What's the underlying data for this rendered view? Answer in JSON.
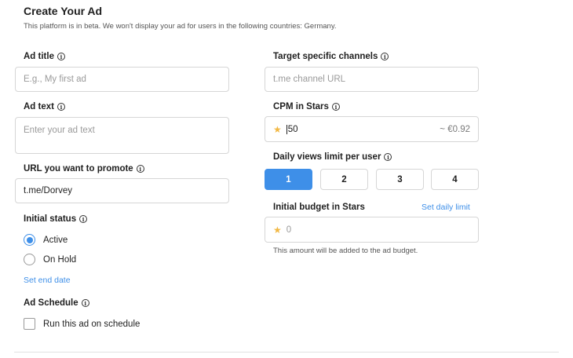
{
  "header": {
    "title": "Create Your Ad",
    "subtitle": "This platform is in beta. We won't display your ad for users in the following countries: Germany."
  },
  "info_icon": "i",
  "ad_title": {
    "label": "Ad title",
    "placeholder": "E.g., My first ad"
  },
  "ad_text": {
    "label": "Ad text",
    "placeholder": "Enter your ad text"
  },
  "url": {
    "label": "URL you want to promote",
    "value": "t.me/Dorvey"
  },
  "initial_status": {
    "label": "Initial status",
    "options": [
      {
        "label": "Active",
        "selected": true
      },
      {
        "label": "On Hold",
        "selected": false
      }
    ],
    "set_end_date": "Set end date"
  },
  "ad_schedule": {
    "label": "Ad Schedule",
    "checkbox_label": "Run this ad on schedule",
    "checked": false
  },
  "target_channels": {
    "label": "Target specific channels",
    "placeholder": "t.me channel URL"
  },
  "cpm": {
    "label": "CPM in Stars",
    "value": "50",
    "fiat": "~ €0.92",
    "icon": "star-icon"
  },
  "daily_views": {
    "label": "Daily views limit per user",
    "options": [
      "1",
      "2",
      "3",
      "4"
    ],
    "selected": "1"
  },
  "budget": {
    "label": "Initial budget in Stars",
    "set_daily_limit": "Set daily limit",
    "placeholder": "0",
    "note": "This amount will be added to the ad budget.",
    "icon": "star-icon"
  },
  "colors": {
    "accent": "#3e8fe8",
    "star": "#f2b844",
    "border": "#d6d6d6"
  }
}
